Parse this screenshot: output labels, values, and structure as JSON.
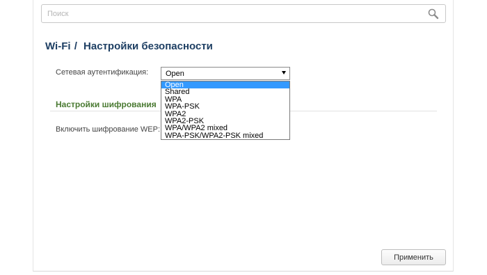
{
  "search": {
    "placeholder": "Поиск",
    "icon": "search-icon"
  },
  "header": {
    "section": "Wi-Fi",
    "separator": "/",
    "title": "Настройки безопасности"
  },
  "auth": {
    "label": "Сетевая аутентификация:",
    "selected": "Open",
    "options": [
      "Open",
      "Shared",
      "WPA",
      "WPA-PSK",
      "WPA2",
      "WPA2-PSK",
      "WPA/WPA2 mixed",
      "WPA-PSK/WPA2-PSK mixed"
    ]
  },
  "encryption": {
    "section_title": "Настройки шифрования",
    "wep_label": "Включить шифрование WEP:"
  },
  "footer": {
    "apply_label": "Применить"
  },
  "colors": {
    "title": "#1e3f63",
    "section": "#4a7a32",
    "highlight": "#3399ff"
  }
}
